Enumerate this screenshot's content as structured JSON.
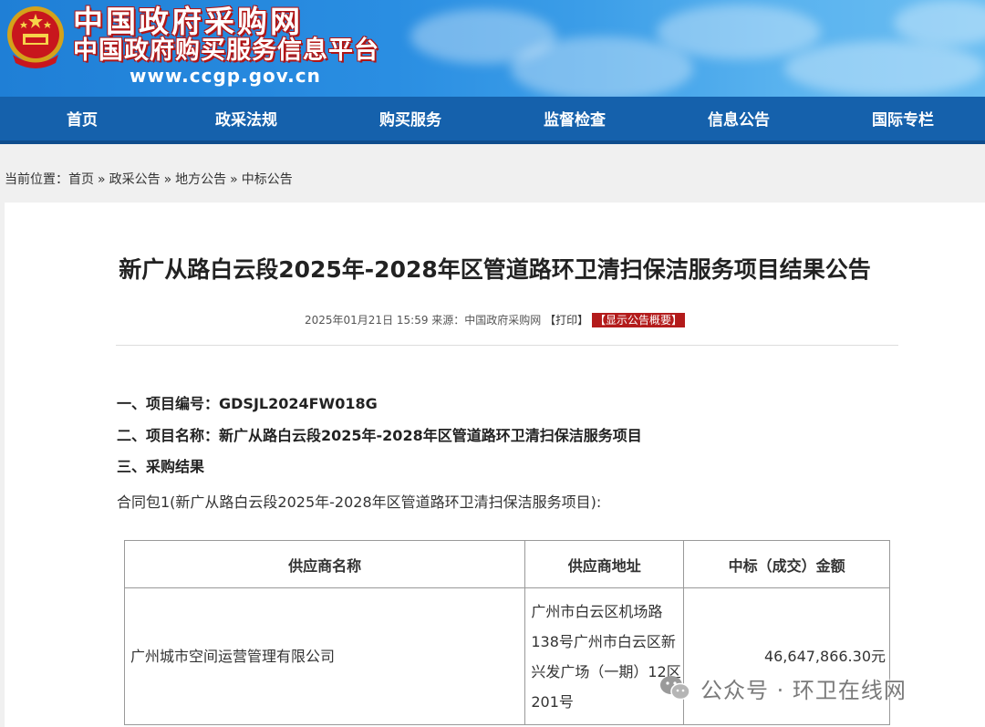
{
  "header": {
    "title": "中国政府采购网",
    "subtitle": "中国政府购买服务信息平台",
    "url": "www.ccgp.gov.cn"
  },
  "nav": {
    "items": [
      "首页",
      "政采法规",
      "购买服务",
      "监督检查",
      "信息公告",
      "国际专栏"
    ]
  },
  "breadcrumb": {
    "prefix": "当前位置：",
    "items": [
      "首页",
      "政采公告",
      "地方公告",
      "中标公告"
    ],
    "separator": "»"
  },
  "article": {
    "title": "新广从路白云段2025年-2028年区管道路环卫清扫保洁服务项目结果公告",
    "meta_date": "2025年01月21日 15:59",
    "meta_source": "来源：中国政府采购网",
    "print_label": "【打印】",
    "summary_label": "【显示公告概要】",
    "sections": [
      "一、项目编号：GDSJL2024FW018G",
      "二、项目名称：新广从路白云段2025年-2028年区管道路环卫清扫保洁服务项目",
      "三、采购结果"
    ],
    "package_line": "合同包1(新广从路白云段2025年-2028年区管道路环卫清扫保洁服务项目):",
    "table": {
      "headers": [
        "供应商名称",
        "供应商地址",
        "中标（成交）金额"
      ],
      "rows": [
        [
          "广州城市空间运营管理有限公司",
          "广州市白云区机场路138号广州市白云区新兴发广场（一期）12区201号",
          "46,647,866.30元"
        ]
      ]
    }
  },
  "watermark": {
    "text": "公众号 · 环卫在线网"
  },
  "colors": {
    "nav_bg": "#1561ac",
    "banner": "#2a8ee2",
    "accent_red": "#b31b1b"
  }
}
